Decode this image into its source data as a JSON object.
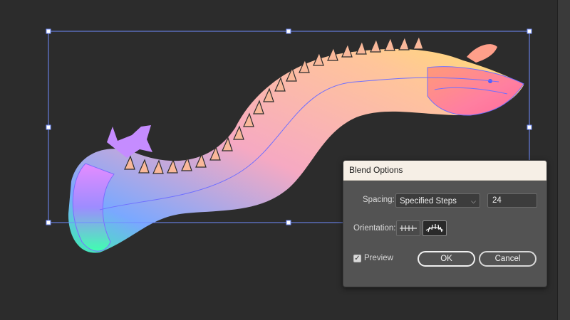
{
  "dialog": {
    "title": "Blend Options",
    "spacing_label": "Spacing:",
    "spacing_value": "Specified Steps",
    "steps_value": "24",
    "orientation_label": "Orientation:",
    "orientation_selected": "align-to-path",
    "preview_label": "Preview",
    "preview_checked": true,
    "ok_label": "OK",
    "cancel_label": "Cancel"
  },
  "icons": {
    "orientation_page": "align-to-page-icon",
    "orientation_path": "align-to-path-icon",
    "checkbox": "checkmark-icon",
    "dropdown": "chevron-down-icon"
  },
  "colors": {
    "canvas_bg": "#2c2c2c",
    "dialog_bg": "#535353",
    "titlebar_bg": "#f6efe6",
    "selection": "#6f8cff",
    "gradient_start": "#66a8ff",
    "gradient_mid": "#f7a8b8",
    "gradient_end": "#ffd36b"
  }
}
